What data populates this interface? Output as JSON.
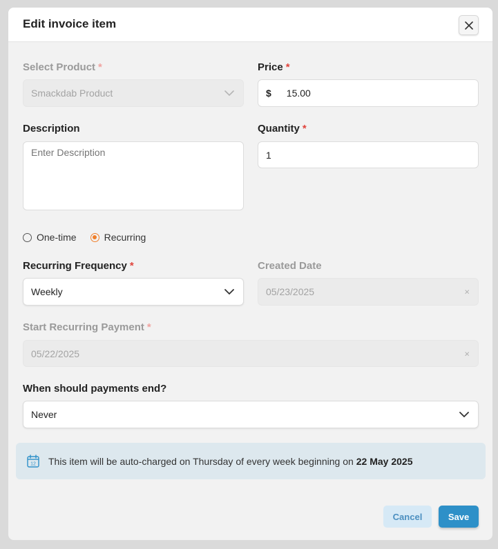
{
  "modal": {
    "title": "Edit invoice item"
  },
  "product": {
    "label": "Select Product",
    "required_mark": "*",
    "value": "Smackdab Product"
  },
  "price": {
    "label": "Price",
    "required_mark": "*",
    "currency": "$",
    "value": "15.00"
  },
  "description": {
    "label": "Description",
    "placeholder": "Enter Description"
  },
  "quantity": {
    "label": "Quantity",
    "required_mark": "*",
    "value": "1"
  },
  "billing_type": {
    "options": [
      "One-time",
      "Recurring"
    ],
    "selected": "Recurring"
  },
  "recurring_frequency": {
    "label": "Recurring Frequency",
    "required_mark": "*",
    "value": "Weekly"
  },
  "created_date": {
    "label": "Created Date",
    "value": "05/23/2025",
    "clear": "×"
  },
  "start_recurring": {
    "label": "Start Recurring Payment",
    "required_mark": "*",
    "value": "05/22/2025",
    "clear": "×"
  },
  "payments_end": {
    "label": "When should payments end?",
    "value": "Never"
  },
  "info": {
    "icon": "calendar-icon",
    "text": "This item will be auto-charged on Thursday of every week beginning on",
    "date": "22 May 2025"
  },
  "buttons": {
    "cancel": "Cancel",
    "save": "Save"
  },
  "colors": {
    "accent_orange": "#f07f2a",
    "save_blue": "#2e90c8",
    "cancel_bg": "#d6e9f6",
    "info_bg": "#dde8ee",
    "required_red": "#e0443c"
  }
}
